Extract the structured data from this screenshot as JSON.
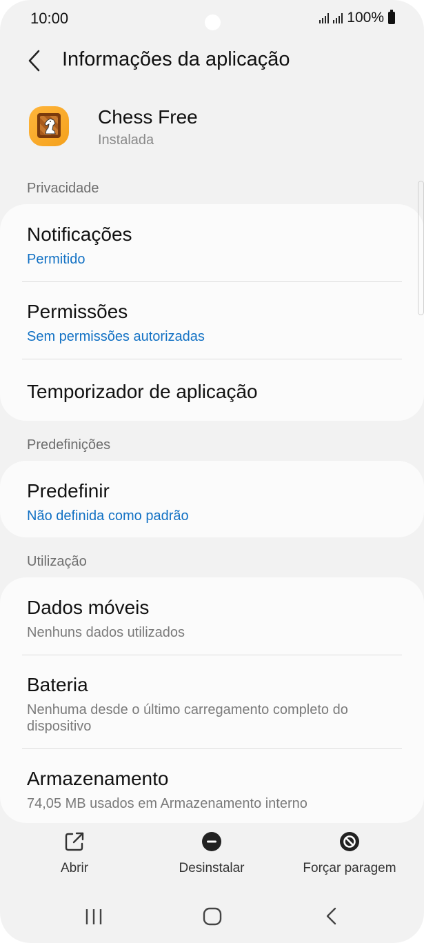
{
  "status_bar": {
    "time": "10:00",
    "battery": "100%"
  },
  "header": {
    "title": "Informações da aplicação",
    "back_icon": "chevron-left-icon"
  },
  "app": {
    "name": "Chess Free",
    "status": "Instalada",
    "icon": "chess-knight-icon"
  },
  "sections": {
    "privacy": {
      "header": "Privacidade",
      "items": [
        {
          "title": "Notificações",
          "subtitle": "Permitido"
        },
        {
          "title": "Permissões",
          "subtitle": "Sem permissões autorizadas"
        },
        {
          "title": "Temporizador de aplicação"
        }
      ]
    },
    "defaults": {
      "header": "Predefinições",
      "items": [
        {
          "title": "Predefinir",
          "subtitle": "Não definida como padrão"
        }
      ]
    },
    "usage": {
      "header": "Utilização",
      "items": [
        {
          "title": "Dados móveis",
          "subtitle": "Nenhuns dados utilizados"
        },
        {
          "title": "Bateria",
          "subtitle": "Nenhuma desde o último carregamento completo do dispositivo"
        },
        {
          "title": "Armazenamento",
          "subtitle": "74,05 MB usados em Armazenamento interno"
        }
      ]
    }
  },
  "actions": {
    "open": {
      "label": "Abrir",
      "icon": "open-external-icon"
    },
    "uninstall": {
      "label": "Desinstalar",
      "icon": "minus-circle-icon"
    },
    "force_stop": {
      "label": "Forçar paragem",
      "icon": "block-icon"
    }
  },
  "colors": {
    "accent_blue": "#1271c4",
    "background": "#f2f2f2",
    "card": "#fbfbfb"
  }
}
